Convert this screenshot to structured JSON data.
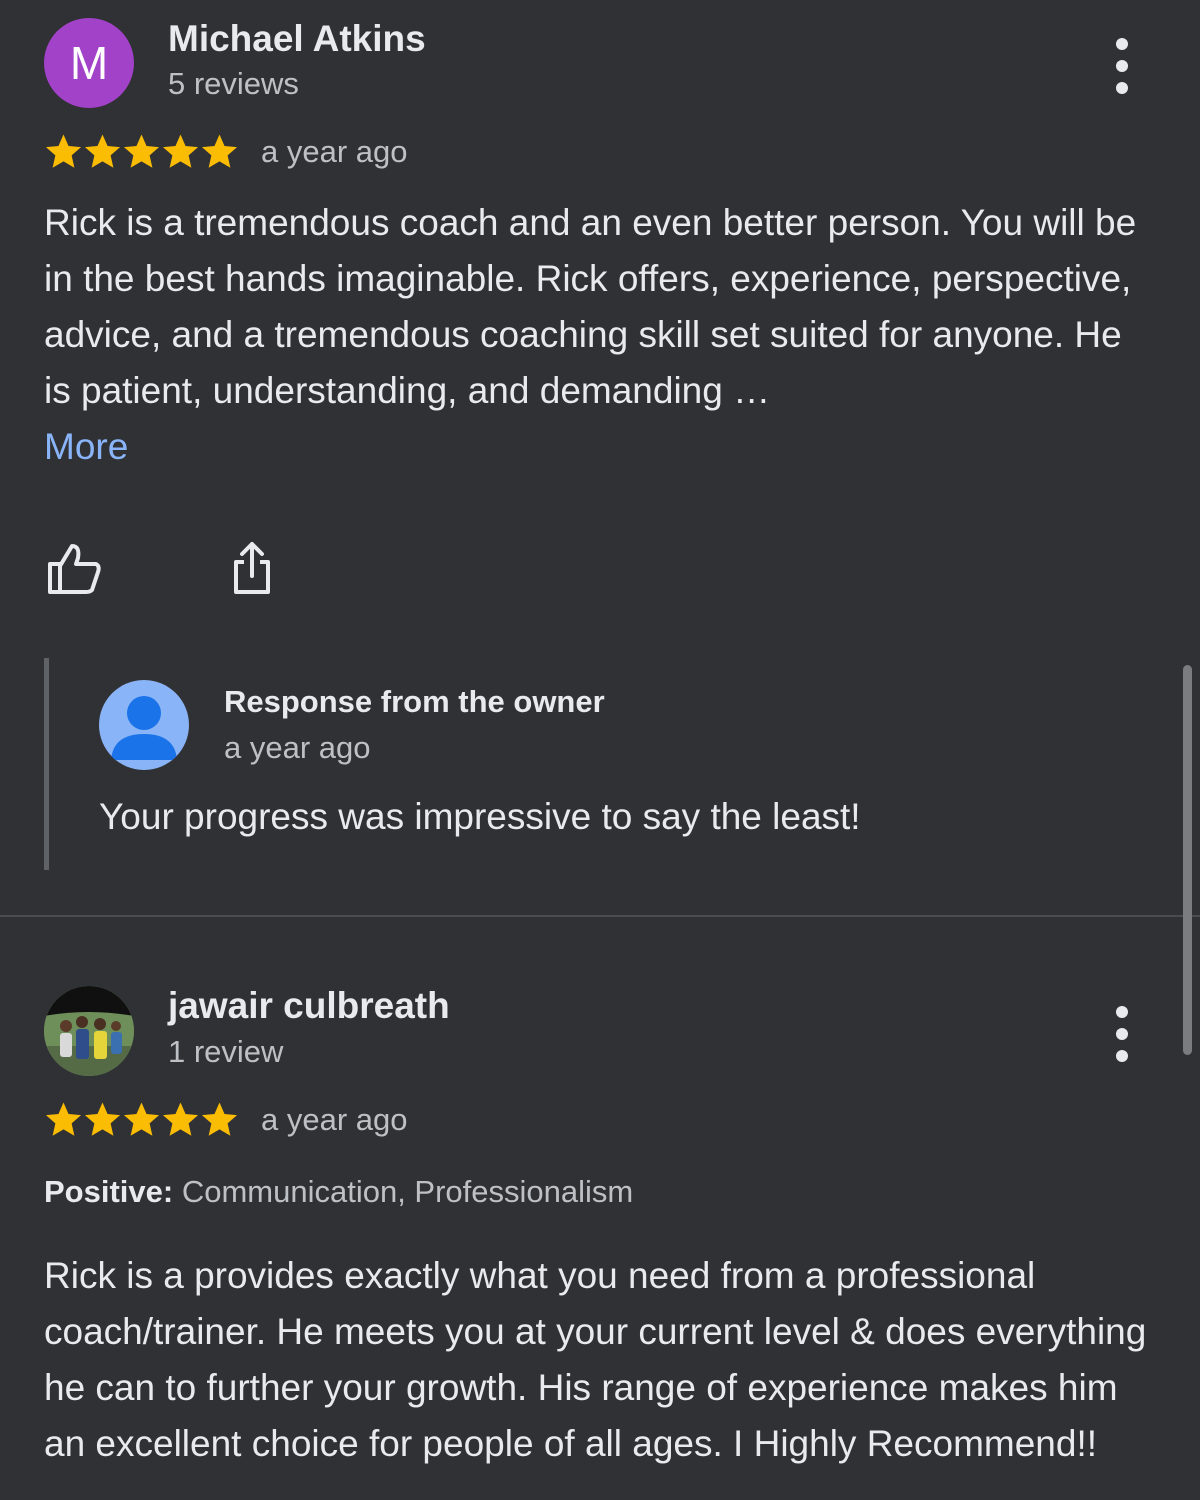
{
  "colors": {
    "background": "#303134",
    "star": "#fbbc04",
    "link": "#8ab4f8",
    "avatar_m": "#a142c8",
    "owner_avatar": "#8ab4f8"
  },
  "reviews": [
    {
      "avatar_letter": "M",
      "author": "Michael Atkins",
      "review_count": "5 reviews",
      "rating": 5,
      "time": "a year ago",
      "text": "Rick is a tremendous coach and an even better person. You will be in the best hands imaginable. Rick offers, experience, perspective, advice, and a tremendous coaching skill set suited for anyone. He is patient, understanding, and demanding …",
      "more_label": "More",
      "icons": [
        "thumb-up-icon",
        "share-icon",
        "more-vert-icon"
      ],
      "owner_response": {
        "title": "Response from the owner",
        "time": "a year ago",
        "text": "Your progress was impressive to say the least!",
        "icon": "person-icon"
      }
    },
    {
      "author": "jawair culbreath",
      "review_count": "1 review",
      "rating": 5,
      "time": "a year ago",
      "positive_label": "Positive:",
      "positive_values": "Communication, Professionalism",
      "text": "Rick is a provides exactly what you need from a professional coach/trainer. He meets you at your current level & does everything he can to further your growth. His range of experience makes him an excellent choice for people of all ages. I Highly Recommend!!",
      "icons": [
        "more-vert-icon"
      ]
    }
  ]
}
